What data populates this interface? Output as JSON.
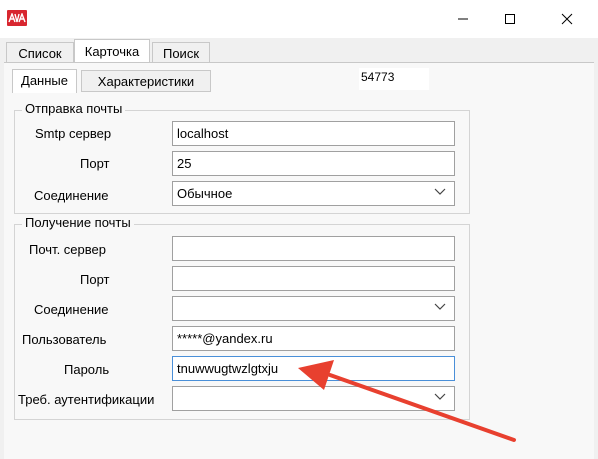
{
  "window": {
    "title": "",
    "controls": [
      "minimize",
      "maximize",
      "close"
    ]
  },
  "tabs_top": [
    "Список",
    "Карточка",
    "Поиск"
  ],
  "tabs_sub": [
    "Данные",
    "Характеристики"
  ],
  "code_field": "54773",
  "send_group": {
    "title": "Отправка почты",
    "smtp_label": "Smtp сервер",
    "smtp_value": "localhost",
    "port_label": "Порт",
    "port_value": "25",
    "conn_label": "Соединение",
    "conn_value": "Обычное"
  },
  "recv_group": {
    "title": "Получение почты",
    "server_label": "Почт. сервер",
    "server_value": "",
    "port_label": "Порт",
    "port_value": "",
    "conn_label": "Соединение",
    "conn_value": "",
    "user_label": "Пользователь",
    "user_value": "*****@yandex.ru",
    "pass_label": "Пароль",
    "pass_value": "tnuwwugtwzlgtxju",
    "auth_label": "Треб. аутентификации",
    "auth_value": ""
  },
  "colors": {
    "app_icon": "#d8262f",
    "annotation_arrow": "#e8402f",
    "window_bg": "#f0f0f0",
    "focus_border": "#4a8fd8"
  },
  "icons": {
    "app": "app-logo-icon",
    "minimize": "minimize-icon",
    "maximize": "maximize-icon",
    "close": "close-icon",
    "dropdown": "chevron-down-icon",
    "annotation": "arrow-annotation"
  }
}
